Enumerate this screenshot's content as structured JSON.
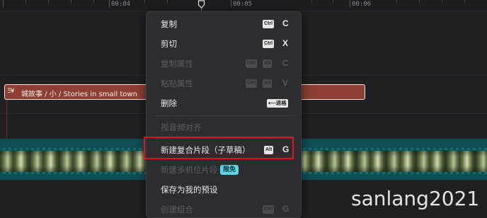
{
  "ruler": {
    "labels": [
      "00:04",
      "00:05",
      "00:06"
    ]
  },
  "text_clip": {
    "icon_text": "Ξ¥",
    "label": "城故事 / 小 / Stories in small town"
  },
  "context_menu": {
    "items": {
      "copy": {
        "label": "复制",
        "kbd": "Ctrl",
        "key": "C"
      },
      "cut": {
        "label": "剪切",
        "kbd": "Ctrl",
        "key": "X"
      },
      "copy_attr": {
        "label": "复制属性",
        "kbd1": "Ctrl",
        "kbd2": "Alt",
        "key": "C"
      },
      "paste_attr": {
        "label": "粘贴属性",
        "kbd1": "Ctrl",
        "kbd2": "Alt",
        "key": "V"
      },
      "delete": {
        "label": "删除",
        "kbd": "⟵退格"
      },
      "av_align": {
        "label": "视音频对齐"
      },
      "new_compound": {
        "label": "新建复合片段（子草稿）",
        "kbd": "Alt",
        "key": "G"
      },
      "new_multicam": {
        "label": "新建多机位片段",
        "badge": "限免"
      },
      "save_preset": {
        "label": "保存为我的预设"
      },
      "create_group": {
        "label": "创建组合",
        "kbd": "Ctrl",
        "key": "G"
      }
    }
  },
  "watermark": "sanlang2021",
  "colors": {
    "highlight": "#e3141c",
    "text_clip": "#8e3f33",
    "video_track": "#0f4e55",
    "badge": "#5fd6e6"
  }
}
